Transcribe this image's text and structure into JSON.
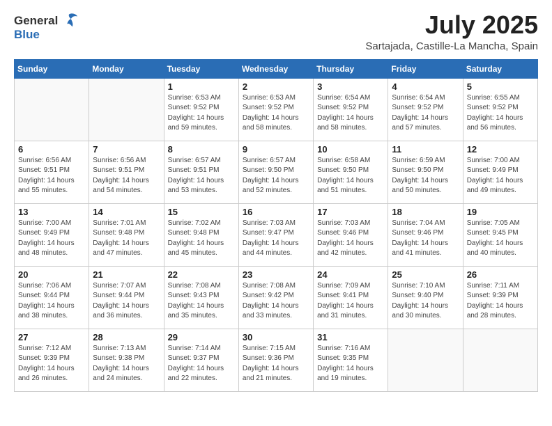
{
  "header": {
    "logo_general": "General",
    "logo_blue": "Blue",
    "month_title": "July 2025",
    "location": "Sartajada, Castille-La Mancha, Spain"
  },
  "weekdays": [
    "Sunday",
    "Monday",
    "Tuesday",
    "Wednesday",
    "Thursday",
    "Friday",
    "Saturday"
  ],
  "weeks": [
    [
      {
        "day": "",
        "info": ""
      },
      {
        "day": "",
        "info": ""
      },
      {
        "day": "1",
        "info": "Sunrise: 6:53 AM\nSunset: 9:52 PM\nDaylight: 14 hours and 59 minutes."
      },
      {
        "day": "2",
        "info": "Sunrise: 6:53 AM\nSunset: 9:52 PM\nDaylight: 14 hours and 58 minutes."
      },
      {
        "day": "3",
        "info": "Sunrise: 6:54 AM\nSunset: 9:52 PM\nDaylight: 14 hours and 58 minutes."
      },
      {
        "day": "4",
        "info": "Sunrise: 6:54 AM\nSunset: 9:52 PM\nDaylight: 14 hours and 57 minutes."
      },
      {
        "day": "5",
        "info": "Sunrise: 6:55 AM\nSunset: 9:52 PM\nDaylight: 14 hours and 56 minutes."
      }
    ],
    [
      {
        "day": "6",
        "info": "Sunrise: 6:56 AM\nSunset: 9:51 PM\nDaylight: 14 hours and 55 minutes."
      },
      {
        "day": "7",
        "info": "Sunrise: 6:56 AM\nSunset: 9:51 PM\nDaylight: 14 hours and 54 minutes."
      },
      {
        "day": "8",
        "info": "Sunrise: 6:57 AM\nSunset: 9:51 PM\nDaylight: 14 hours and 53 minutes."
      },
      {
        "day": "9",
        "info": "Sunrise: 6:57 AM\nSunset: 9:50 PM\nDaylight: 14 hours and 52 minutes."
      },
      {
        "day": "10",
        "info": "Sunrise: 6:58 AM\nSunset: 9:50 PM\nDaylight: 14 hours and 51 minutes."
      },
      {
        "day": "11",
        "info": "Sunrise: 6:59 AM\nSunset: 9:50 PM\nDaylight: 14 hours and 50 minutes."
      },
      {
        "day": "12",
        "info": "Sunrise: 7:00 AM\nSunset: 9:49 PM\nDaylight: 14 hours and 49 minutes."
      }
    ],
    [
      {
        "day": "13",
        "info": "Sunrise: 7:00 AM\nSunset: 9:49 PM\nDaylight: 14 hours and 48 minutes."
      },
      {
        "day": "14",
        "info": "Sunrise: 7:01 AM\nSunset: 9:48 PM\nDaylight: 14 hours and 47 minutes."
      },
      {
        "day": "15",
        "info": "Sunrise: 7:02 AM\nSunset: 9:48 PM\nDaylight: 14 hours and 45 minutes."
      },
      {
        "day": "16",
        "info": "Sunrise: 7:03 AM\nSunset: 9:47 PM\nDaylight: 14 hours and 44 minutes."
      },
      {
        "day": "17",
        "info": "Sunrise: 7:03 AM\nSunset: 9:46 PM\nDaylight: 14 hours and 42 minutes."
      },
      {
        "day": "18",
        "info": "Sunrise: 7:04 AM\nSunset: 9:46 PM\nDaylight: 14 hours and 41 minutes."
      },
      {
        "day": "19",
        "info": "Sunrise: 7:05 AM\nSunset: 9:45 PM\nDaylight: 14 hours and 40 minutes."
      }
    ],
    [
      {
        "day": "20",
        "info": "Sunrise: 7:06 AM\nSunset: 9:44 PM\nDaylight: 14 hours and 38 minutes."
      },
      {
        "day": "21",
        "info": "Sunrise: 7:07 AM\nSunset: 9:44 PM\nDaylight: 14 hours and 36 minutes."
      },
      {
        "day": "22",
        "info": "Sunrise: 7:08 AM\nSunset: 9:43 PM\nDaylight: 14 hours and 35 minutes."
      },
      {
        "day": "23",
        "info": "Sunrise: 7:08 AM\nSunset: 9:42 PM\nDaylight: 14 hours and 33 minutes."
      },
      {
        "day": "24",
        "info": "Sunrise: 7:09 AM\nSunset: 9:41 PM\nDaylight: 14 hours and 31 minutes."
      },
      {
        "day": "25",
        "info": "Sunrise: 7:10 AM\nSunset: 9:40 PM\nDaylight: 14 hours and 30 minutes."
      },
      {
        "day": "26",
        "info": "Sunrise: 7:11 AM\nSunset: 9:39 PM\nDaylight: 14 hours and 28 minutes."
      }
    ],
    [
      {
        "day": "27",
        "info": "Sunrise: 7:12 AM\nSunset: 9:39 PM\nDaylight: 14 hours and 26 minutes."
      },
      {
        "day": "28",
        "info": "Sunrise: 7:13 AM\nSunset: 9:38 PM\nDaylight: 14 hours and 24 minutes."
      },
      {
        "day": "29",
        "info": "Sunrise: 7:14 AM\nSunset: 9:37 PM\nDaylight: 14 hours and 22 minutes."
      },
      {
        "day": "30",
        "info": "Sunrise: 7:15 AM\nSunset: 9:36 PM\nDaylight: 14 hours and 21 minutes."
      },
      {
        "day": "31",
        "info": "Sunrise: 7:16 AM\nSunset: 9:35 PM\nDaylight: 14 hours and 19 minutes."
      },
      {
        "day": "",
        "info": ""
      },
      {
        "day": "",
        "info": ""
      }
    ]
  ]
}
